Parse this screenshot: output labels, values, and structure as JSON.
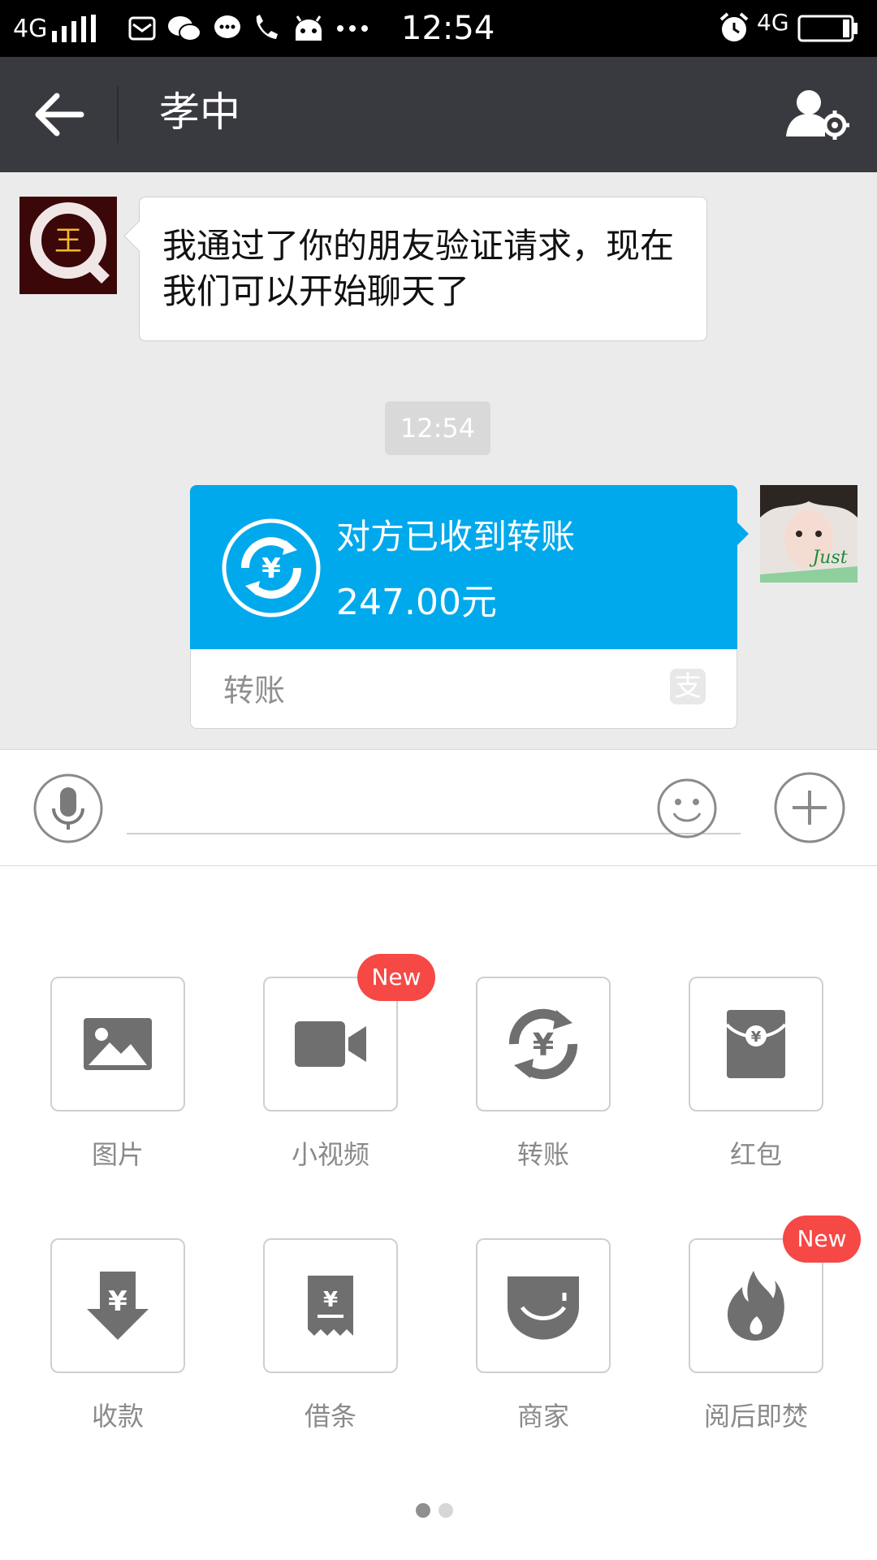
{
  "status_bar": {
    "network": "4G",
    "time": "12:54",
    "network_right": "4G",
    "icons": [
      "signal-icon",
      "mail-icon",
      "wechat-icon",
      "message-icon",
      "call-icon",
      "android-icon",
      "more-dots-icon",
      "alarm-icon",
      "battery-icon"
    ]
  },
  "header": {
    "title": "孝中",
    "back_icon": "back-arrow-icon",
    "settings_icon": "contact-settings-icon"
  },
  "chat": {
    "incoming_message": "我通过了你的朋友验证请求，现在我们可以开始聊天了",
    "timestamp": "12:54",
    "transfer": {
      "status": "对方已收到转账",
      "amount": "247.00元",
      "footer_label": "转账",
      "footer_logo": "支"
    }
  },
  "input_bar": {
    "placeholder": "",
    "mic_icon": "microphone-icon",
    "emoji_icon": "emoji-icon",
    "plus_icon": "plus-icon"
  },
  "tools": [
    {
      "label": "图片",
      "icon": "image-icon",
      "badge": ""
    },
    {
      "label": "小视频",
      "icon": "video-camera-icon",
      "badge": "New"
    },
    {
      "label": "转账",
      "icon": "transfer-icon",
      "badge": ""
    },
    {
      "label": "红包",
      "icon": "red-packet-icon",
      "badge": ""
    },
    {
      "label": "收款",
      "icon": "receive-money-icon",
      "badge": ""
    },
    {
      "label": "借条",
      "icon": "iou-icon",
      "badge": ""
    },
    {
      "label": "商家",
      "icon": "merchant-icon",
      "badge": ""
    },
    {
      "label": "阅后即焚",
      "icon": "burn-after-reading-icon",
      "badge": "New"
    }
  ],
  "pager": {
    "pages": 2,
    "current": 1
  },
  "colors": {
    "header_bg": "#393a3f",
    "chat_bg": "#ebebeb",
    "transfer_blue": "#00a9ec",
    "badge_red": "#f64845",
    "icon_gray": "#6f6f6f"
  }
}
